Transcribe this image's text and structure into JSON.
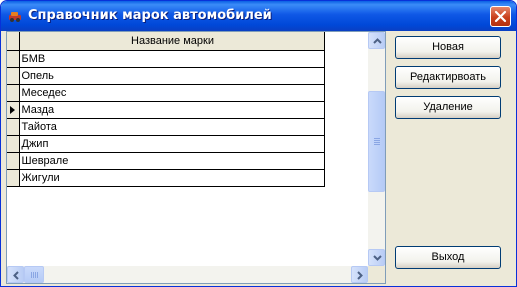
{
  "window": {
    "title": "Справочник марок автомобилей"
  },
  "grid": {
    "column_header": "Название марки",
    "rows": [
      "БМВ",
      "Опель",
      "Меседес",
      "Мазда",
      "Тайота",
      "Джип",
      "Шеврале",
      "Жигули"
    ],
    "current_row": "Мазда"
  },
  "buttons": {
    "new": "Новая",
    "edit": "Редактирвоать",
    "delete": "Удаление",
    "exit": "Выход"
  },
  "colors": {
    "title_bar": "#0a5fe4",
    "close_button": "#c9401c",
    "face": "#ece9d8",
    "scroll_accent": "#b9cdf5"
  },
  "icons": [
    "car-icon",
    "close-icon",
    "row-pointer-icon",
    "scroll-up-icon",
    "scroll-down-icon",
    "scroll-left-icon",
    "scroll-right-icon"
  ]
}
